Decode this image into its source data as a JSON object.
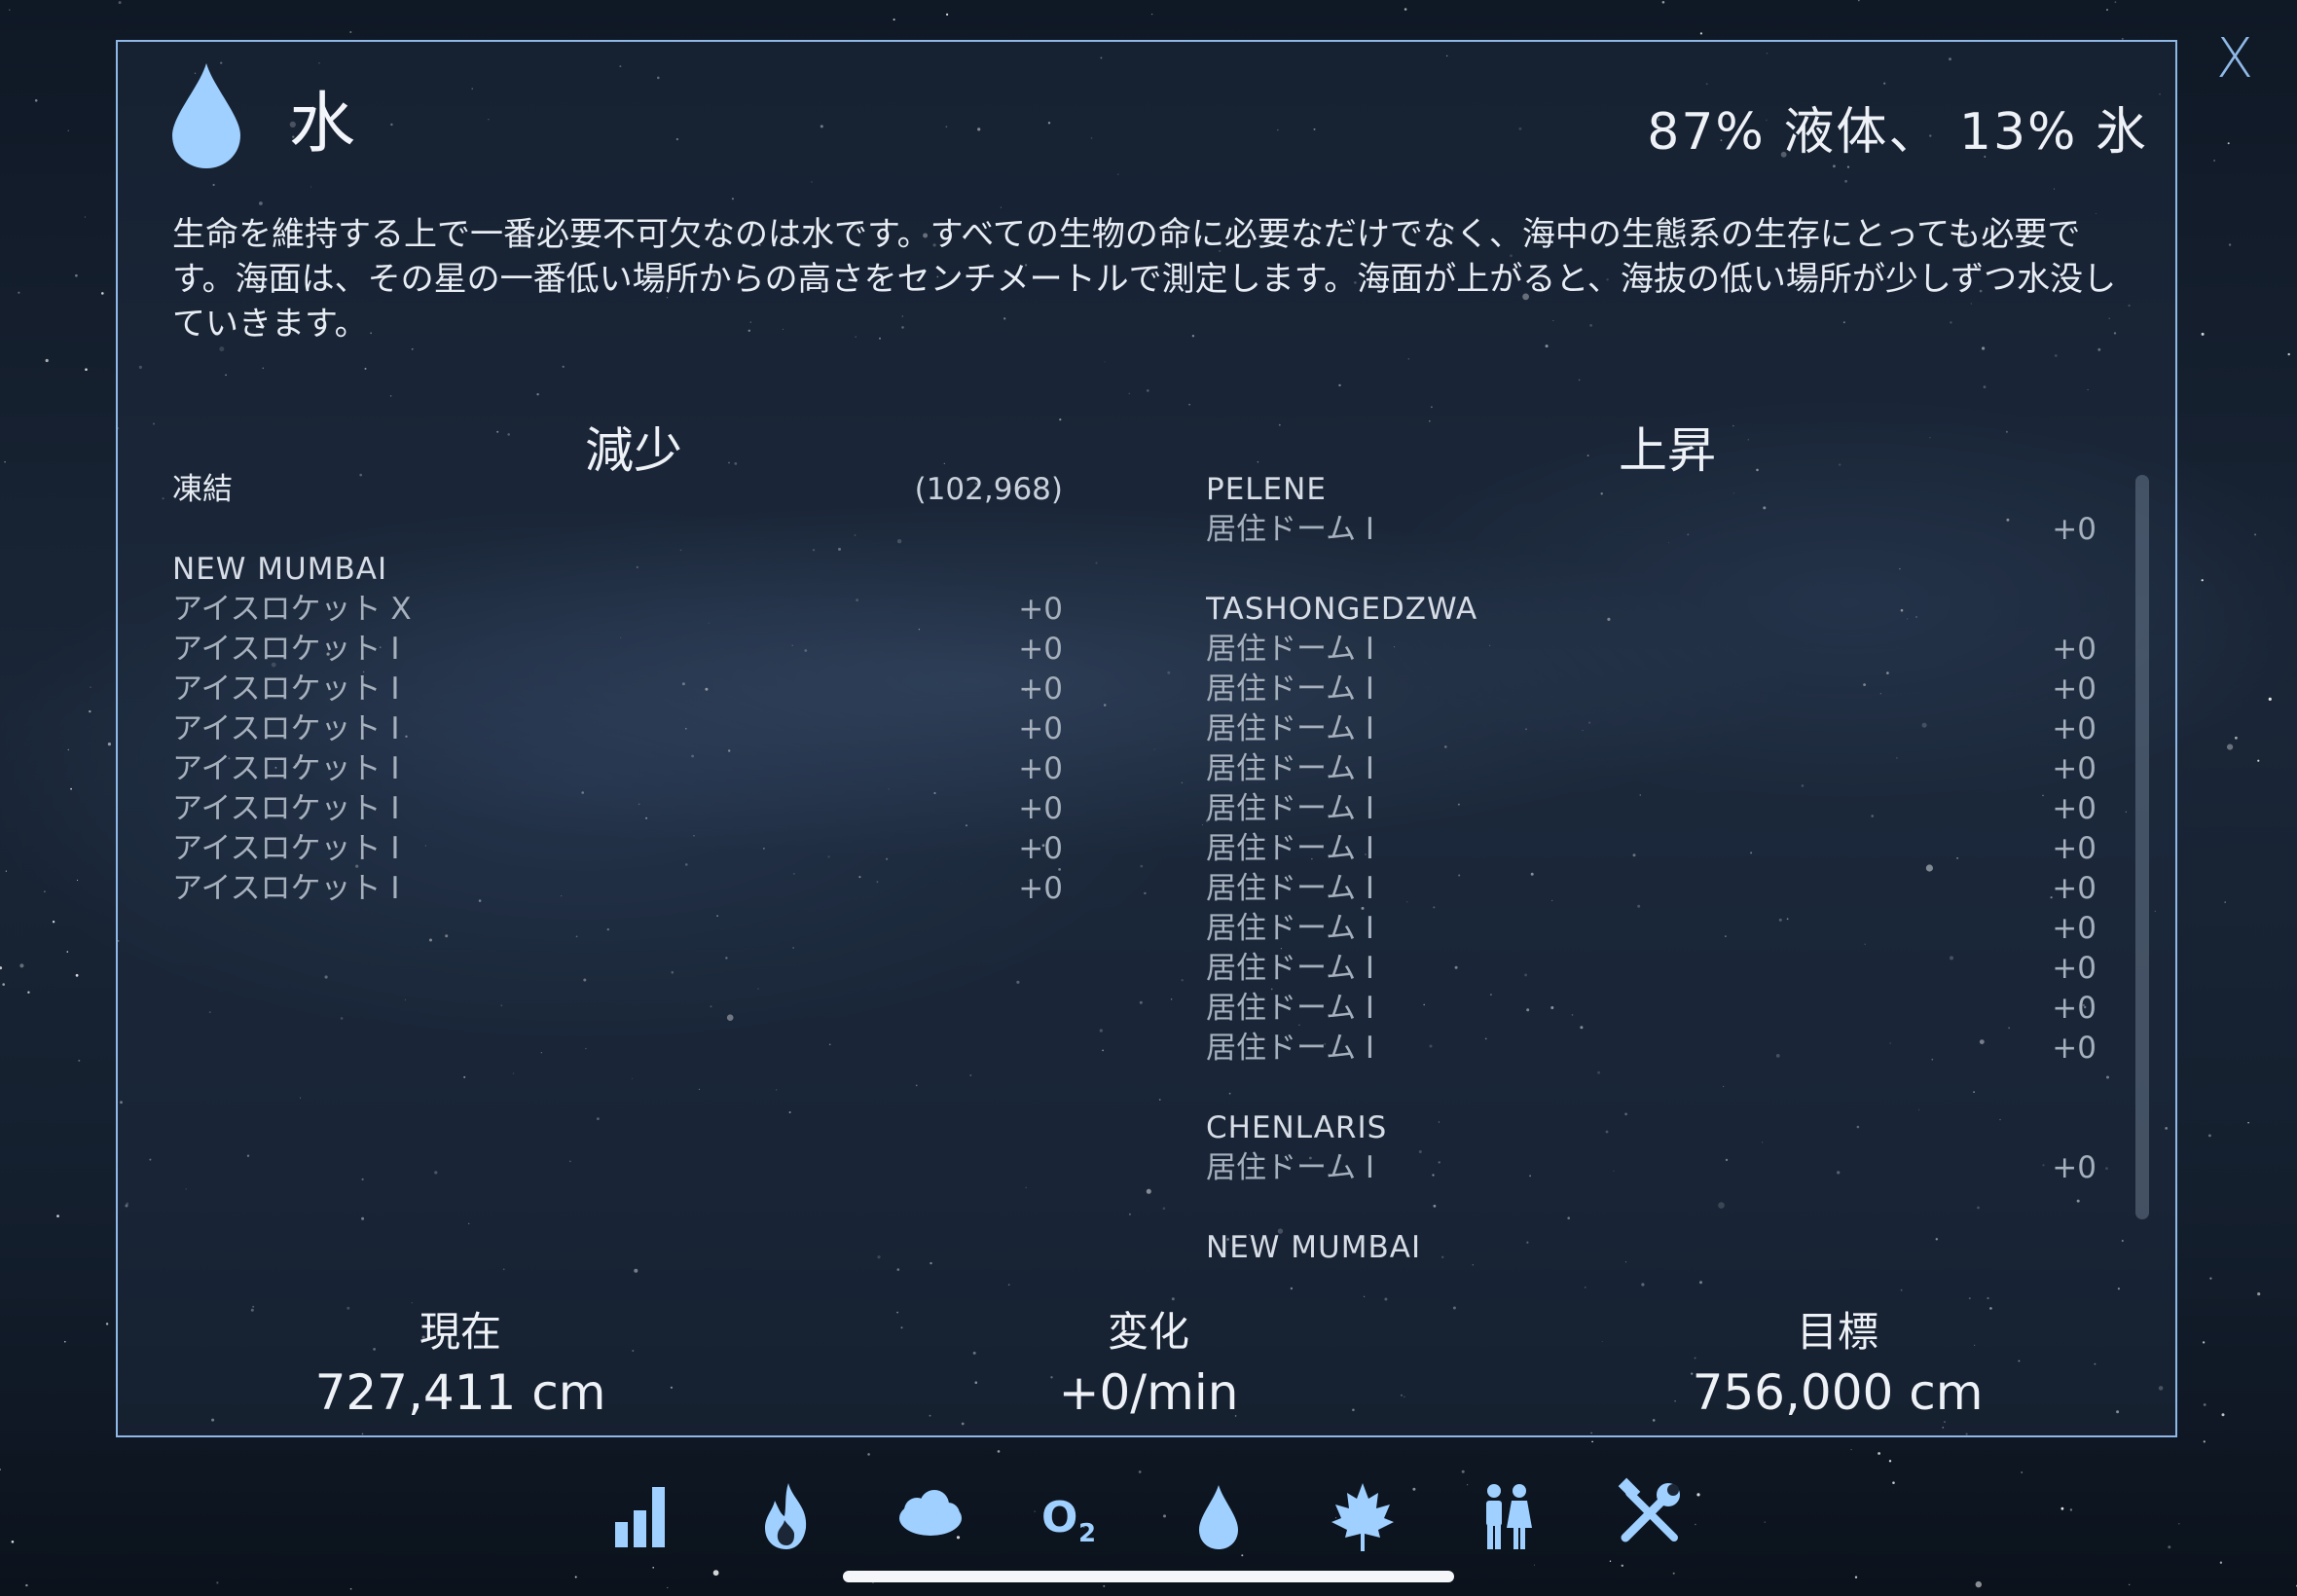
{
  "colors": {
    "accent": "#8fb8e6",
    "water": "#9fd0ff",
    "text": "#eef2f7",
    "dim_text": "#a6b0bd"
  },
  "close_label": "X",
  "header": {
    "icon": "water-drop-icon",
    "title": "水",
    "state": "87% 液体、 13% 氷"
  },
  "description": "生命を維持する上で一番必要不可欠なのは水です。すべての生物の命に必要なだけでなく、海中の生態系の生存にとっても必要です。海面は、その星の一番低い場所からの高さをセンチメートルで測定します。海面が上がると、海抜の低い場所が少しずつ水没していきます。",
  "decrease": {
    "heading": "減少",
    "freeze": {
      "label": "凍結",
      "value": "(102,968)"
    },
    "groups": [
      {
        "city": "NEW MUMBAI",
        "items": [
          {
            "label": "アイスロケット X",
            "value": "+0"
          },
          {
            "label": "アイスロケット I",
            "value": "+0"
          },
          {
            "label": "アイスロケット I",
            "value": "+0"
          },
          {
            "label": "アイスロケット I",
            "value": "+0"
          },
          {
            "label": "アイスロケット I",
            "value": "+0"
          },
          {
            "label": "アイスロケット I",
            "value": "+0"
          },
          {
            "label": "アイスロケット I",
            "value": "+0"
          },
          {
            "label": "アイスロケット I",
            "value": "+0"
          }
        ]
      }
    ]
  },
  "increase": {
    "heading": "上昇",
    "groups": [
      {
        "city": "PELENE",
        "items": [
          {
            "label": "居住ドーム I",
            "value": "+0"
          }
        ]
      },
      {
        "city": "TASHONGEDZWA",
        "items": [
          {
            "label": "居住ドーム I",
            "value": "+0"
          },
          {
            "label": "居住ドーム I",
            "value": "+0"
          },
          {
            "label": "居住ドーム I",
            "value": "+0"
          },
          {
            "label": "居住ドーム I",
            "value": "+0"
          },
          {
            "label": "居住ドーム I",
            "value": "+0"
          },
          {
            "label": "居住ドーム I",
            "value": "+0"
          },
          {
            "label": "居住ドーム I",
            "value": "+0"
          },
          {
            "label": "居住ドーム I",
            "value": "+0"
          },
          {
            "label": "居住ドーム I",
            "value": "+0"
          },
          {
            "label": "居住ドーム I",
            "value": "+0"
          },
          {
            "label": "居住ドーム I",
            "value": "+0"
          }
        ]
      },
      {
        "city": "CHENLARIS",
        "items": [
          {
            "label": "居住ドーム I",
            "value": "+0"
          }
        ]
      },
      {
        "city": "NEW MUMBAI",
        "items": []
      }
    ]
  },
  "stats": {
    "current": {
      "label": "現在",
      "value": "727,411 cm"
    },
    "change": {
      "label": "変化",
      "value": "+0/min"
    },
    "target": {
      "label": "目標",
      "value": "756,000 cm"
    }
  },
  "tabs": [
    {
      "name": "stats-icon",
      "active": false
    },
    {
      "name": "heat-icon",
      "active": false
    },
    {
      "name": "atmosphere-cloud-icon",
      "active": false
    },
    {
      "name": "oxygen-icon",
      "label": "O2",
      "active": false
    },
    {
      "name": "water-icon",
      "active": true
    },
    {
      "name": "biomass-leaf-icon",
      "active": false
    },
    {
      "name": "population-icon",
      "active": false
    },
    {
      "name": "tools-icon",
      "active": false
    }
  ]
}
